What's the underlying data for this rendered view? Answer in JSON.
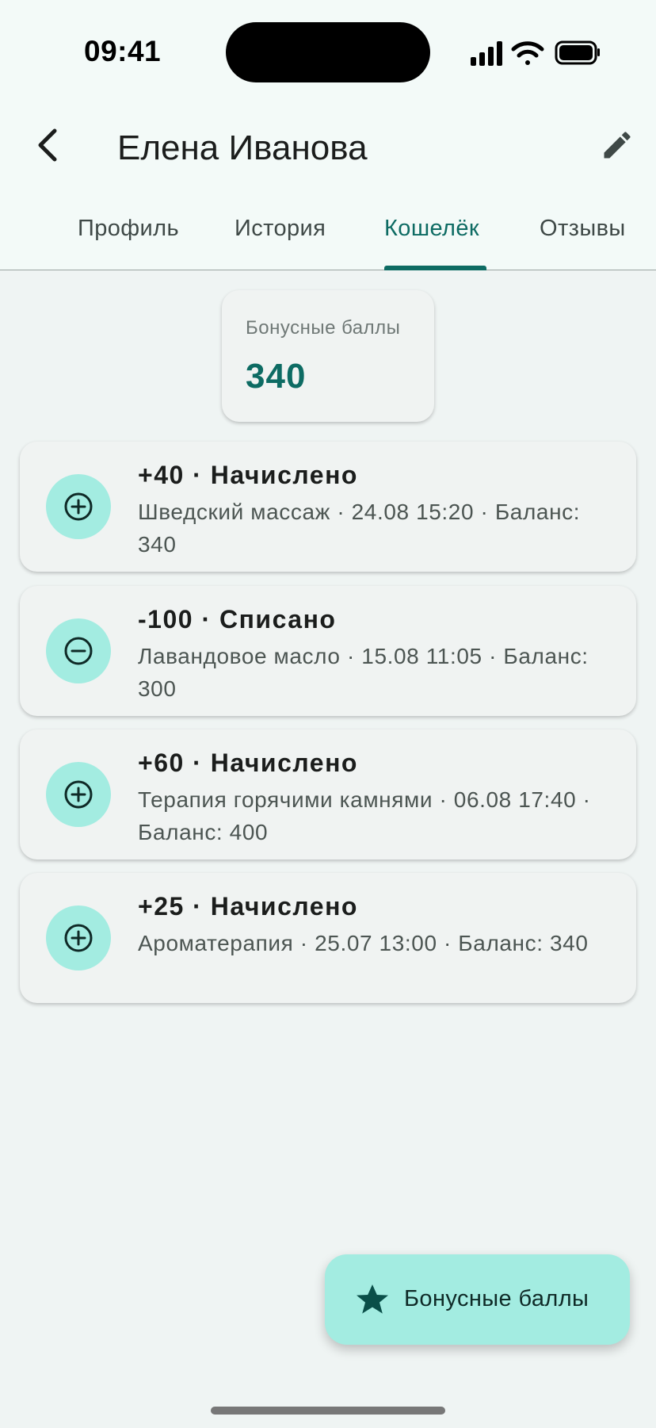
{
  "status_bar": {
    "time": "09:41"
  },
  "app_bar": {
    "title": "Елена Иванова"
  },
  "tabs": [
    {
      "label": "Профиль",
      "active": false
    },
    {
      "label": "История",
      "active": false
    },
    {
      "label": "Кошелёк",
      "active": true
    },
    {
      "label": "Отзывы",
      "active": false
    }
  ],
  "bonus": {
    "label": "Бонусные баллы",
    "value": "340"
  },
  "transactions": [
    {
      "type": "credit",
      "icon": "plus-circle-icon",
      "title": "+40 · Начислено",
      "detail": "Шведский массаж · 24.08 15:20 · Баланс: 340"
    },
    {
      "type": "debit",
      "icon": "minus-circle-icon",
      "title": "-100 · Списано",
      "detail": "Лавандовое масло · 15.08 11:05 · Баланс: 300"
    },
    {
      "type": "credit",
      "icon": "plus-circle-icon",
      "title": "+60 · Начислено",
      "detail": "Терапия горячими камнями · 06.08 17:40 · Баланс: 400"
    },
    {
      "type": "credit",
      "icon": "plus-circle-icon",
      "title": "+25 · Начислено",
      "detail": "Ароматерапия · 25.07 13:00 · Баланс: 340"
    }
  ],
  "fab": {
    "label": "Бонусные баллы",
    "icon": "star-icon"
  },
  "colors": {
    "accent": "#0d6b63",
    "icon_bg": "#a3ece1",
    "background": "#eff4f3",
    "card": "#f0f3f2"
  }
}
